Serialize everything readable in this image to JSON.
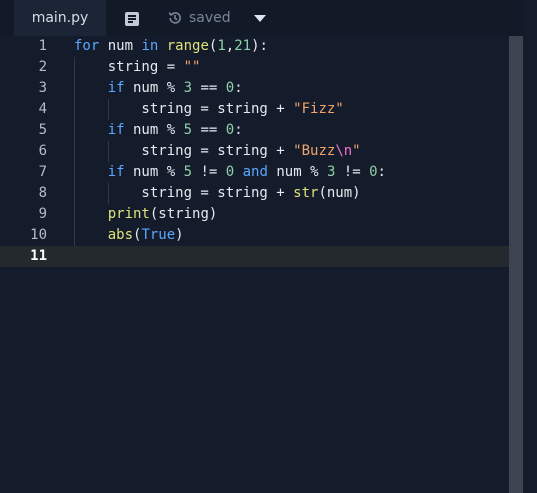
{
  "toolbar": {
    "tab_label": "main.py",
    "doc_icon": "document-icon",
    "history_icon": "history-icon",
    "status_label": "saved",
    "dropdown_icon": "caret-down-icon"
  },
  "editor": {
    "language": "python",
    "active_line": 11,
    "lines": [
      {
        "number": "1",
        "tokens": [
          {
            "t": "kw",
            "v": "for"
          },
          {
            "t": "id",
            "v": " num "
          },
          {
            "t": "kw",
            "v": "in"
          },
          {
            "t": "id",
            "v": " "
          },
          {
            "t": "fn",
            "v": "range"
          },
          {
            "t": "op",
            "v": "("
          },
          {
            "t": "num",
            "v": "1"
          },
          {
            "t": "op",
            "v": ","
          },
          {
            "t": "num",
            "v": "21"
          },
          {
            "t": "op",
            "v": "):"
          }
        ]
      },
      {
        "number": "2",
        "tokens": [
          {
            "t": "id",
            "v": "    string = "
          },
          {
            "t": "str",
            "v": "\"\""
          }
        ]
      },
      {
        "number": "3",
        "tokens": [
          {
            "t": "id",
            "v": "    "
          },
          {
            "t": "kw",
            "v": "if"
          },
          {
            "t": "id",
            "v": " num % "
          },
          {
            "t": "num",
            "v": "3"
          },
          {
            "t": "id",
            "v": " == "
          },
          {
            "t": "num",
            "v": "0"
          },
          {
            "t": "op",
            "v": ":"
          }
        ]
      },
      {
        "number": "4",
        "tokens": [
          {
            "t": "id",
            "v": "        string = string + "
          },
          {
            "t": "str",
            "v": "\"Fizz\""
          }
        ]
      },
      {
        "number": "5",
        "tokens": [
          {
            "t": "id",
            "v": "    "
          },
          {
            "t": "kw",
            "v": "if"
          },
          {
            "t": "id",
            "v": " num % "
          },
          {
            "t": "num",
            "v": "5"
          },
          {
            "t": "id",
            "v": " == "
          },
          {
            "t": "num",
            "v": "0"
          },
          {
            "t": "op",
            "v": ":"
          }
        ]
      },
      {
        "number": "6",
        "tokens": [
          {
            "t": "id",
            "v": "        string = string + "
          },
          {
            "t": "str",
            "v": "\"Buzz"
          },
          {
            "t": "esc",
            "v": "\\n"
          },
          {
            "t": "str",
            "v": "\""
          }
        ]
      },
      {
        "number": "7",
        "tokens": [
          {
            "t": "id",
            "v": "    "
          },
          {
            "t": "kw",
            "v": "if"
          },
          {
            "t": "id",
            "v": " num % "
          },
          {
            "t": "num",
            "v": "5"
          },
          {
            "t": "id",
            "v": " != "
          },
          {
            "t": "num",
            "v": "0"
          },
          {
            "t": "id",
            "v": " "
          },
          {
            "t": "kw",
            "v": "and"
          },
          {
            "t": "id",
            "v": " num % "
          },
          {
            "t": "num",
            "v": "3"
          },
          {
            "t": "id",
            "v": " != "
          },
          {
            "t": "num",
            "v": "0"
          },
          {
            "t": "op",
            "v": ":"
          }
        ]
      },
      {
        "number": "8",
        "tokens": [
          {
            "t": "id",
            "v": "        string = string + "
          },
          {
            "t": "fn",
            "v": "str"
          },
          {
            "t": "op",
            "v": "(num)"
          }
        ]
      },
      {
        "number": "9",
        "tokens": [
          {
            "t": "id",
            "v": "    "
          },
          {
            "t": "fn",
            "v": "print"
          },
          {
            "t": "op",
            "v": "(string)"
          }
        ]
      },
      {
        "number": "10",
        "tokens": [
          {
            "t": "id",
            "v": "    "
          },
          {
            "t": "fn",
            "v": "abs"
          },
          {
            "t": "op",
            "v": "("
          },
          {
            "t": "const",
            "v": "True"
          },
          {
            "t": "op",
            "v": ")"
          }
        ]
      },
      {
        "number": "11",
        "tokens": []
      }
    ]
  }
}
